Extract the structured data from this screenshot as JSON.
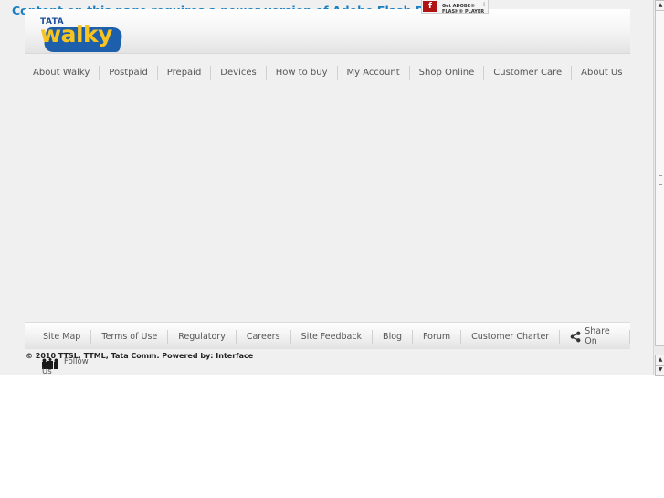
{
  "flash": {
    "message": "Content on this page requires a newer version of Adobe Flash Player.",
    "badge_logo": "f",
    "badge_text": "Get ADOBE® FLASH® PLAYER"
  },
  "brand": {
    "tata": "TATA",
    "walky": "walky"
  },
  "nav": {
    "items": [
      {
        "label": "About Walky"
      },
      {
        "label": "Postpaid"
      },
      {
        "label": "Prepaid"
      },
      {
        "label": "Devices"
      },
      {
        "label": "How to buy"
      },
      {
        "label": "My Account"
      },
      {
        "label": "Shop Online"
      },
      {
        "label": "Customer Care"
      },
      {
        "label": "About Us"
      }
    ]
  },
  "footer": {
    "links": [
      {
        "label": "Site Map"
      },
      {
        "label": "Terms of Use"
      },
      {
        "label": "Regulatory"
      },
      {
        "label": "Careers"
      },
      {
        "label": "Site Feedback"
      },
      {
        "label": "Blog"
      },
      {
        "label": "Forum"
      },
      {
        "label": "Customer Charter"
      }
    ],
    "share_label": "Share On",
    "copyright": "© 2010 TTSL, TTML, Tata Comm. Powered by: Interface",
    "follow_label": "Follow",
    "follow_label_2": "Us"
  },
  "colors": {
    "accent": "#1a7fc1",
    "brand_blue": "#1d5fab",
    "brand_yellow": "#f7c41f"
  },
  "icons": {
    "share": "share-icon",
    "follow": "people-icon",
    "flash": "flash-player-icon"
  }
}
